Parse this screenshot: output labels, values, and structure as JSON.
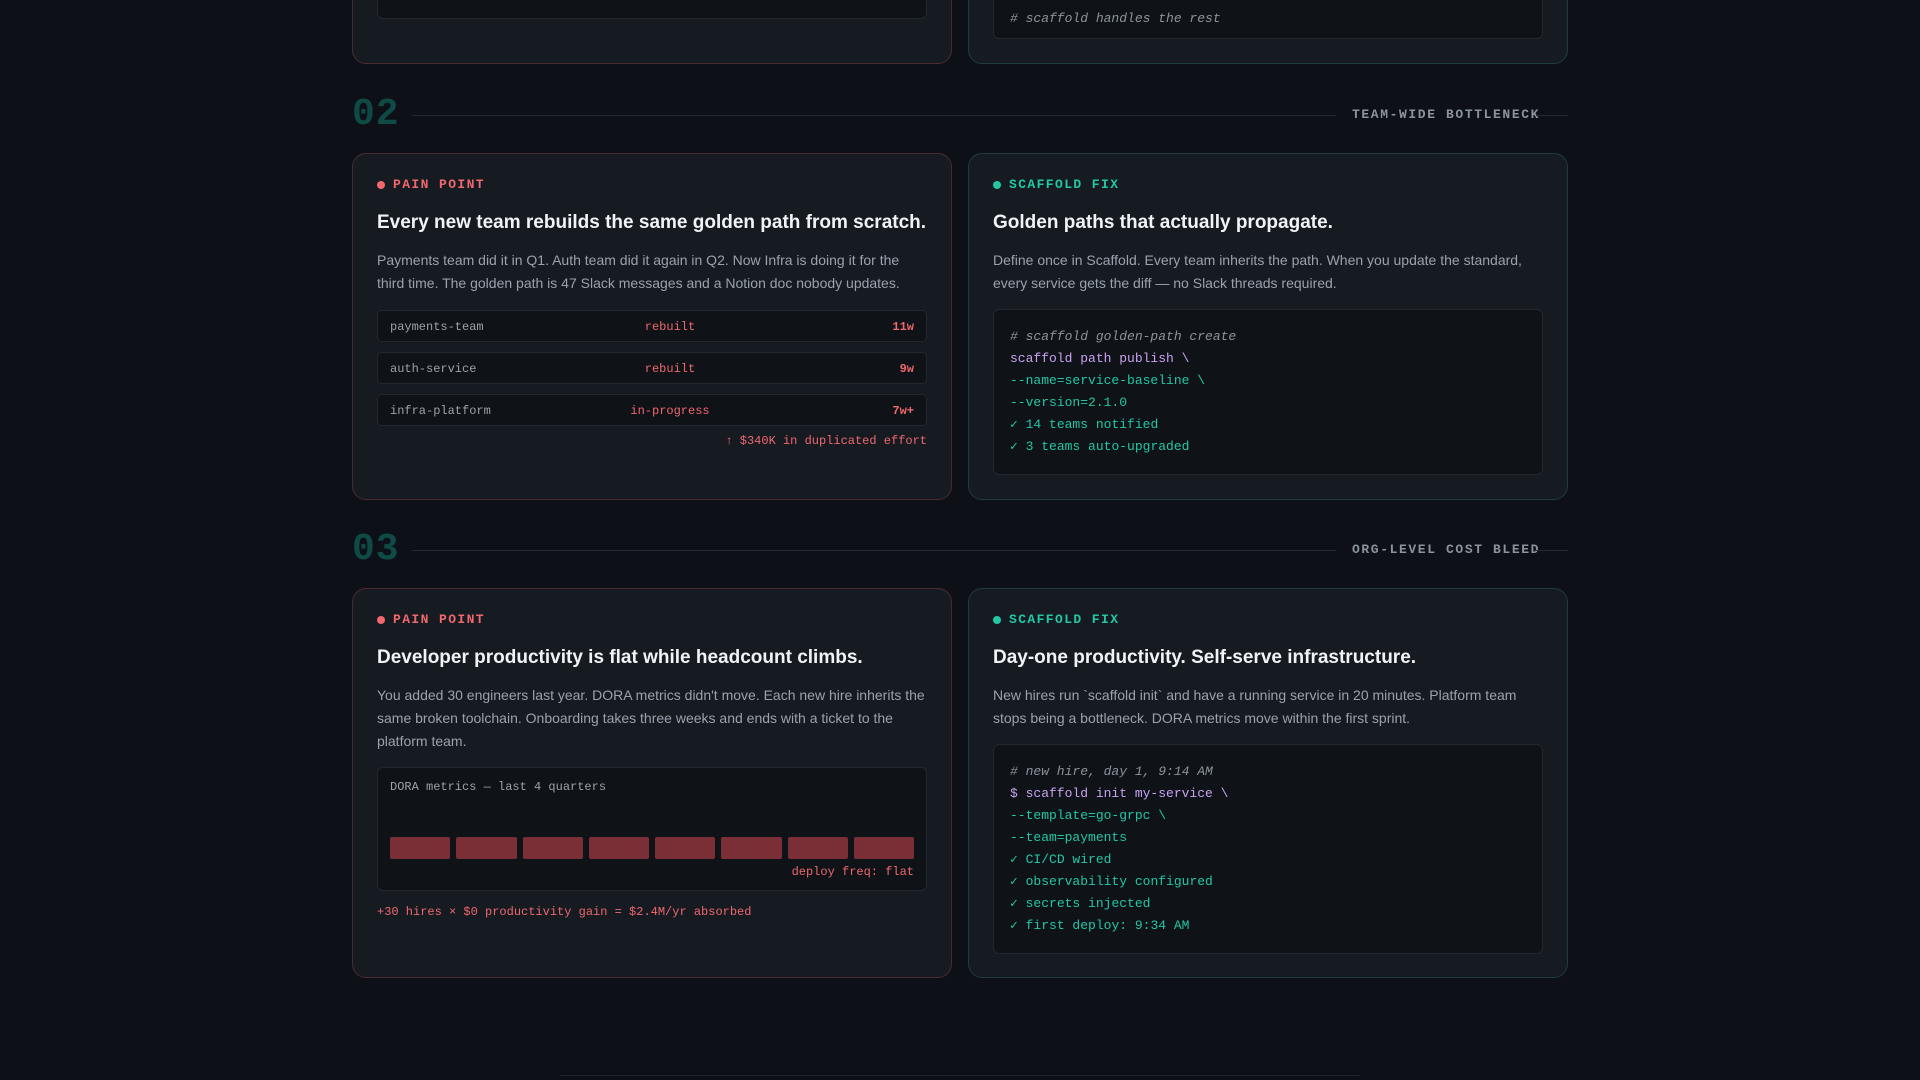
{
  "top": {
    "right_comment": "# scaffold handles the rest"
  },
  "sections": [
    {
      "number": "02",
      "tag": "TEAM-WIDE BOTTLENECK",
      "pain": {
        "kicker": "PAIN POINT",
        "title": "Every new team rebuilds the same golden path from scratch.",
        "description": "Payments team did it in Q1. Auth team did it again in Q2. Now Infra is doing it for the third time. The golden path is 47 Slack messages and a Notion doc nobody updates.",
        "rows": [
          {
            "name": "payments-team",
            "status": "rebuilt",
            "duration": "11w"
          },
          {
            "name": "auth-service",
            "status": "rebuilt",
            "duration": "9w"
          },
          {
            "name": "infra-platform",
            "status": "in-progress",
            "duration": "7w+"
          }
        ],
        "footnote": "↑ $340K in duplicated effort"
      },
      "fix": {
        "kicker": "SCAFFOLD FIX",
        "title": "Golden paths that actually propagate.",
        "description": "Define once in Scaffold. Every team inherits the path. When you update the standard, every service gets the diff — no Slack threads required.",
        "code": [
          {
            "kind": "comment",
            "text": "# scaffold golden-path create"
          },
          {
            "kind": "cmd",
            "text": "scaffold path publish \\"
          },
          {
            "kind": "ok",
            "text": "--name=service-baseline \\"
          },
          {
            "kind": "ok",
            "text": "--version=2.1.0"
          },
          {
            "kind": "ok",
            "text": "✓ 14 teams notified"
          },
          {
            "kind": "ok",
            "text": "✓ 3 teams auto-upgraded"
          }
        ]
      }
    },
    {
      "number": "03",
      "tag": "ORG-LEVEL COST BLEED",
      "pain": {
        "kicker": "PAIN POINT",
        "title": "Developer productivity is flat while headcount climbs.",
        "description": "You added 30 engineers last year. DORA metrics didn't move. Each new hire inherits the same broken toolchain. Onboarding takes three weeks and ends with a ticket to the platform team.",
        "dora_title": "DORA metrics — last 4 quarters",
        "dora_footer": "deploy freq: flat",
        "dora_bars": [
          0.6,
          0.6,
          0.6,
          0.6,
          0.6,
          0.6,
          0.6,
          0.6
        ],
        "footnote": "+30 hires × $0 productivity gain = $2.4M/yr absorbed"
      },
      "fix": {
        "kicker": "SCAFFOLD FIX",
        "title": "Day-one productivity. Self-serve infrastructure.",
        "description": "New hires run `scaffold init` and have a running service in 20 minutes. Platform team stops being a bottleneck. DORA metrics move within the first sprint.",
        "code": [
          {
            "kind": "comment",
            "text": "# new hire, day 1, 9:14 AM"
          },
          {
            "kind": "cmd",
            "text": "$ scaffold init my-service \\"
          },
          {
            "kind": "ok",
            "text": "--template=go-grpc \\"
          },
          {
            "kind": "ok",
            "text": "--team=payments"
          },
          {
            "kind": "ok",
            "text": "✓ CI/CD wired"
          },
          {
            "kind": "ok",
            "text": "✓ observability configured"
          },
          {
            "kind": "ok",
            "text": "✓ secrets injected"
          },
          {
            "kind": "ok",
            "text": "✓ first deploy: 9:34 AM"
          }
        ]
      }
    }
  ]
}
